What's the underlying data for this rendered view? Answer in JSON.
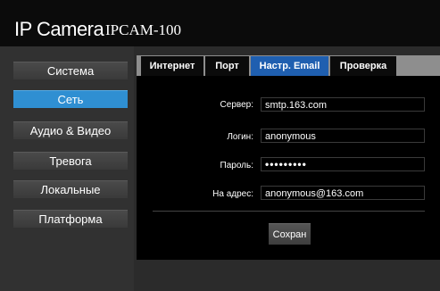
{
  "header": {
    "brand": "IP Camera",
    "model": "IPCAM-100"
  },
  "sidebar": {
    "items": [
      {
        "label": "Система",
        "active": false
      },
      {
        "label": "Сеть",
        "active": true
      },
      {
        "label": "Аудио & Видео",
        "active": false
      },
      {
        "label": "Тревога",
        "active": false
      },
      {
        "label": "Локальные",
        "active": false
      },
      {
        "label": "Платформа",
        "active": false
      }
    ]
  },
  "tabs": [
    {
      "label": "Интернет",
      "active": false
    },
    {
      "label": "Порт",
      "active": false
    },
    {
      "label": "Настр. Email",
      "active": true
    },
    {
      "label": "Проверка",
      "active": false
    }
  ],
  "form": {
    "server_label": "Сервер:",
    "server_value": "smtp.163.com",
    "login_label": "Логин:",
    "login_value": "anonymous",
    "password_label": "Пароль:",
    "password_value": "•••••••••",
    "to_label": "На адрес:",
    "to_value": "anonymous@163.com"
  },
  "save_label": "Сохран",
  "colors": {
    "accent": "#2f8fd2",
    "tab_active": "#1f5fb0",
    "header_bg": "#0b0b0b"
  }
}
